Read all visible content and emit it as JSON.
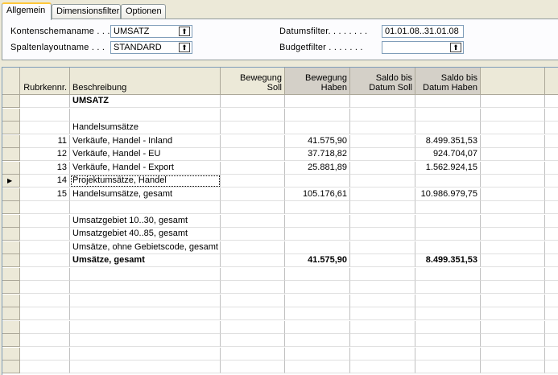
{
  "tabs": [
    {
      "label": "Allgemein",
      "active": true
    },
    {
      "label": "Dimensionsfilter",
      "active": false
    },
    {
      "label": "Optionen",
      "active": false
    }
  ],
  "fields": {
    "kontenschema": {
      "label": "Kontenschemaname . . .",
      "value": "UMSATZ"
    },
    "spaltenlayout": {
      "label": "Spaltenlayoutname . . .",
      "value": "STANDARD"
    },
    "datumsfilter": {
      "label": "Datumsfilter. . . . . . . .",
      "value": "01.01.08..31.01.08"
    },
    "budgetfilter": {
      "label": "Budgetfilter . . . . . . .",
      "value": ""
    }
  },
  "lookup_glyph": "⬆",
  "row_pointer": "▶",
  "columns": [
    "Rubrkennr.",
    "Beschreibung",
    "Bewegung Soll",
    "Bewegung Haben",
    "Saldo bis Datum Soll",
    "Saldo bis Datum Haben"
  ],
  "rows": [
    {
      "nr": "",
      "desc": "UMSATZ",
      "soll": "",
      "haben": "",
      "sdsoll": "",
      "sdhaben": "",
      "bold": true
    },
    {
      "nr": "",
      "desc": "",
      "soll": "",
      "haben": "",
      "sdsoll": "",
      "sdhaben": ""
    },
    {
      "nr": "",
      "desc": "Handelsumsätze",
      "soll": "",
      "haben": "",
      "sdsoll": "",
      "sdhaben": ""
    },
    {
      "nr": "11",
      "desc": "Verkäufe, Handel - Inland",
      "soll": "",
      "haben": "41.575,90",
      "sdsoll": "",
      "sdhaben": "8.499.351,53"
    },
    {
      "nr": "12",
      "desc": "Verkäufe, Handel - EU",
      "soll": "",
      "haben": "37.718,82",
      "sdsoll": "",
      "sdhaben": "924.704,07"
    },
    {
      "nr": "13",
      "desc": "Verkäufe, Handel - Export",
      "soll": "",
      "haben": "25.881,89",
      "sdsoll": "",
      "sdhaben": "1.562.924,15"
    },
    {
      "nr": "14",
      "desc": "Projektumsätze, Handel",
      "soll": "",
      "haben": "",
      "sdsoll": "",
      "sdhaben": "",
      "current": true
    },
    {
      "nr": "15",
      "desc": "Handelsumsätze, gesamt",
      "soll": "",
      "haben": "105.176,61",
      "sdsoll": "",
      "sdhaben": "10.986.979,75"
    },
    {
      "nr": "",
      "desc": "",
      "soll": "",
      "haben": "",
      "sdsoll": "",
      "sdhaben": ""
    },
    {
      "nr": "",
      "desc": "Umsatzgebiet 10..30, gesamt",
      "soll": "",
      "haben": "",
      "sdsoll": "",
      "sdhaben": ""
    },
    {
      "nr": "",
      "desc": "Umsatzgebiet 40..85, gesamt",
      "soll": "",
      "haben": "",
      "sdsoll": "",
      "sdhaben": ""
    },
    {
      "nr": "",
      "desc": "Umsätze, ohne Gebietscode, gesamt",
      "soll": "",
      "haben": "",
      "sdsoll": "",
      "sdhaben": ""
    },
    {
      "nr": "",
      "desc": "Umsätze, gesamt",
      "soll": "",
      "haben": "41.575,90",
      "sdsoll": "",
      "sdhaben": "8.499.351,53",
      "bold": true
    }
  ]
}
